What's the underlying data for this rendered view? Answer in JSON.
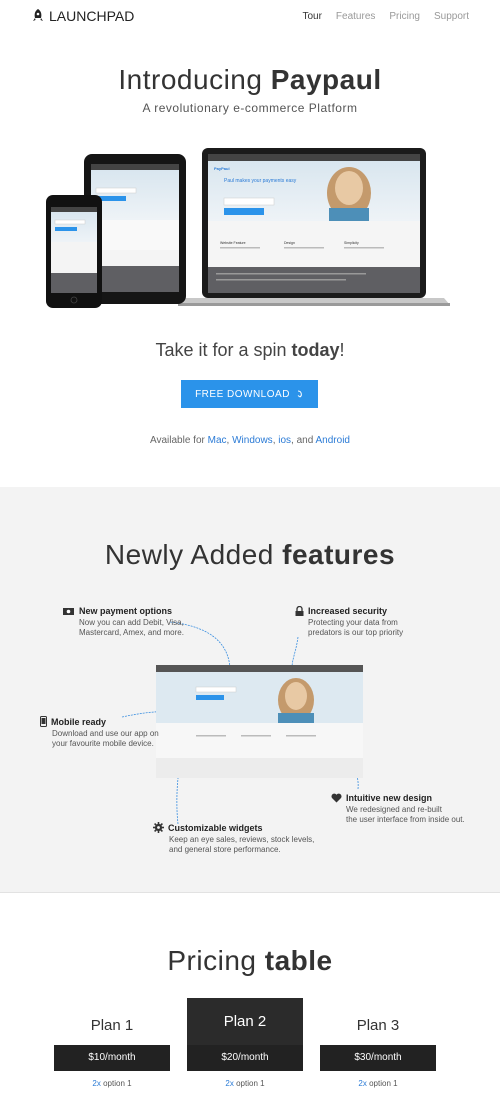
{
  "nav": {
    "brand": "LAUNCHPAD",
    "links": [
      "Tour",
      "Features",
      "Pricing",
      "Support"
    ],
    "active_color": "#333333",
    "inactive_color": "#999999"
  },
  "hero": {
    "title_light": "Introducing ",
    "title_bold": "Paypaul",
    "subtitle": "A revolutionary e-commerce Platform",
    "mock": {
      "brand": "PayPaul",
      "headline": "Paul makes your payments easy",
      "sections": [
        "Website Feature",
        "Design",
        "Simplicity"
      ]
    }
  },
  "cta": {
    "spin_light": "Take it for a spin ",
    "spin_bold": "today",
    "spin_end": "!",
    "button_label": "FREE DOWNLOAD",
    "available_prefix": "Available for ",
    "platforms": [
      "Mac",
      "Windows",
      "ios",
      "Android"
    ],
    "sep1": ", ",
    "sep2": ", ",
    "sep3": ", and ",
    "accent_color": "#2b93ea"
  },
  "features": {
    "title_light": "Newly Added ",
    "title_bold": "features",
    "items": [
      {
        "title": "New payment options",
        "desc1": "Now you can add Debit, Visa,",
        "desc2": "Mastercard, Amex, and more.",
        "icon": "money-icon"
      },
      {
        "title": "Increased security",
        "desc1": "Protecting your data from",
        "desc2": "predators is our top priority",
        "icon": "lock-icon"
      },
      {
        "title": "Mobile ready",
        "desc1": "Download and use our app on",
        "desc2": "your favourite mobile device.",
        "icon": "phone-icon"
      },
      {
        "title": "Intuitive new design",
        "desc1": "We redesigned and re-built",
        "desc2": "the user interface from inside out.",
        "icon": "heart-icon"
      },
      {
        "title": "Customizable widgets",
        "desc1": "Keep an eye sales, reviews, stock levels,",
        "desc2": "and general store performance.",
        "icon": "gear-icon"
      }
    ]
  },
  "pricing": {
    "title_light": "Pricing ",
    "title_bold": "table",
    "plans": [
      {
        "name": "Plan 1",
        "price": "$10/month",
        "opt_num": "2x",
        "opt_label": " option 1"
      },
      {
        "name": "Plan 2",
        "price": "$20/month",
        "opt_num": "2x",
        "opt_label": " option 1"
      },
      {
        "name": "Plan 3",
        "price": "$30/month",
        "opt_num": "2x",
        "opt_label": " option 1"
      }
    ]
  }
}
